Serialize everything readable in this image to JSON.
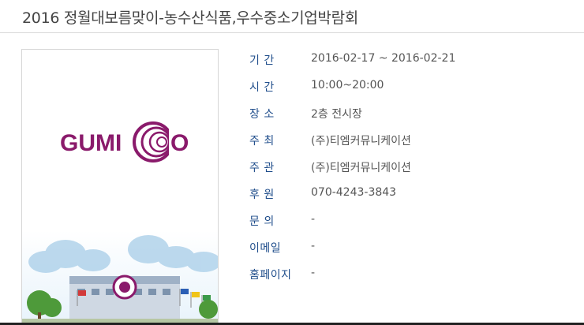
{
  "page": {
    "title": "2016 정월대보름맞이-농수산식품,우수중소기업박람회"
  },
  "poster": {
    "logo_text": "GUMI",
    "logo_tail": "O",
    "logo_color": "#8a1a6b"
  },
  "details": [
    {
      "label": "기 간",
      "value": "2016-02-17 ~ 2016-02-21"
    },
    {
      "label": "시 간",
      "value": "10:00~20:00"
    },
    {
      "label": "장 소",
      "value": "2층 전시장"
    },
    {
      "label": "주 최",
      "value": "(주)티엠커뮤니케이션"
    },
    {
      "label": "주 관",
      "value": "(주)티엠커뮤니케이션"
    },
    {
      "label": "후 원",
      "value": "070-4243-3843"
    },
    {
      "label": "문 의",
      "value": "-"
    },
    {
      "label": "이메일",
      "value": "-"
    },
    {
      "label": "홈페이지",
      "value": "-"
    }
  ],
  "colors": {
    "label": "#1f4d8b",
    "value": "#555555",
    "accent": "#8a1a6b"
  }
}
